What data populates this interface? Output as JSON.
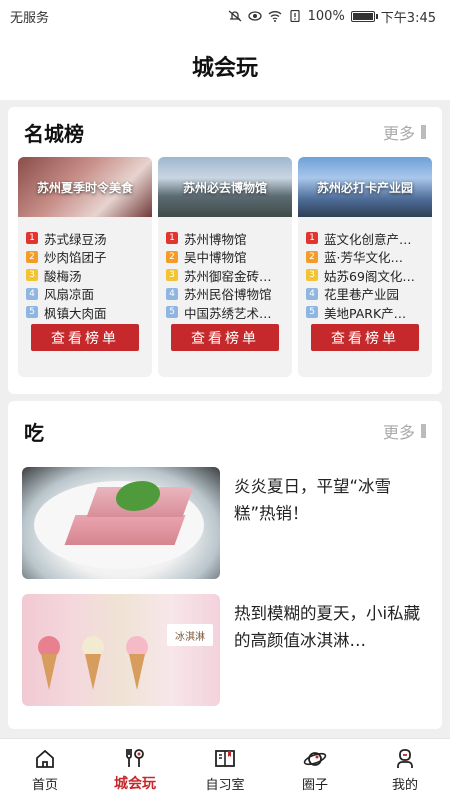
{
  "status_bar": {
    "carrier": "无服务",
    "battery": "100%",
    "time": "下午3:45"
  },
  "header": {
    "title": "城会玩"
  },
  "rankings": {
    "title": "名城榜",
    "more_label": "更多",
    "columns": [
      {
        "image_title": "苏州夏季时令美食",
        "items": [
          "苏式绿豆汤",
          "炒肉馅团子",
          "酸梅汤",
          "风扇凉面",
          "枫镇大肉面"
        ],
        "button_label": "查看榜单"
      },
      {
        "image_title": "苏州必去博物馆",
        "items": [
          "苏州博物馆",
          "吴中博物馆",
          "苏州御窑金砖…",
          "苏州民俗博物馆",
          "中国苏绣艺术…"
        ],
        "button_label": "查看榜单"
      },
      {
        "image_title": "苏州必打卡产业园",
        "items": [
          "蓝文化创意产…",
          "蓝·芳华文化…",
          "姑苏69阁文化…",
          "花里巷产业园",
          "美地PARK产…"
        ],
        "button_label": "查看榜单"
      }
    ]
  },
  "eat": {
    "title": "吃",
    "more_label": "更多",
    "articles": [
      {
        "title": "炎炎夏日，平望“冰雪糕”热销！"
      },
      {
        "title": "热到模糊的夏天，小i私藏的高颜值冰淇淋…",
        "thumb_sign": "冰淇淋"
      }
    ]
  },
  "nav": {
    "items": [
      {
        "label": "首页",
        "icon": "home-icon"
      },
      {
        "label": "城会玩",
        "icon": "food-icon",
        "active": true
      },
      {
        "label": "自习室",
        "icon": "book-icon"
      },
      {
        "label": "圈子",
        "icon": "planet-icon"
      },
      {
        "label": "我的",
        "icon": "profile-icon"
      }
    ]
  },
  "colors": {
    "accent": "#c5292b",
    "rank1": "#e0362f",
    "rank2": "#f39c27",
    "rank3": "#f2c433",
    "rank45": "#8fb6e0"
  }
}
